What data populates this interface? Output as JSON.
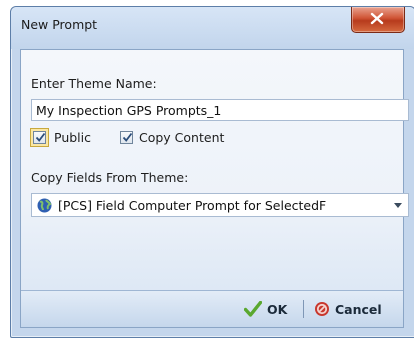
{
  "window": {
    "title": "New Prompt"
  },
  "form": {
    "theme_name_label": "Enter Theme Name:",
    "theme_name_value": "My Inspection GPS Prompts_1",
    "public_label": "Public",
    "public_checked": true,
    "copy_content_label": "Copy Content",
    "copy_content_checked": true,
    "copy_fields_label": "Copy Fields From Theme:",
    "copy_fields_value": "[PCS] Field Computer Prompt for SelectedF"
  },
  "buttons": {
    "ok": "OK",
    "cancel": "Cancel"
  },
  "icons": {
    "close": "close-icon",
    "globe": "globe-icon",
    "dropdown": "chevron-down-icon",
    "ok": "checkmark-icon",
    "cancel": "cancel-icon"
  },
  "colors": {
    "ok_green": "#5aa82f",
    "cancel_red": "#c8372d",
    "close_red": "#c94a2b"
  }
}
